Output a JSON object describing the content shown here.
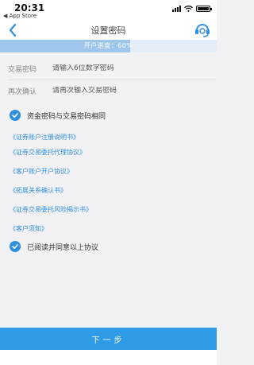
{
  "status_bar": {
    "time": "20:31",
    "back_app": "◀ App Store"
  },
  "nav": {
    "title": "设置密码",
    "back_icon": "chevron-left-icon",
    "service_icon": "customer-service-icon"
  },
  "progress": {
    "text": "开户进度：60%",
    "value": 0.6
  },
  "form": {
    "trade_password": {
      "label": "交易密码",
      "placeholder": "请输入6位数字密码"
    },
    "confirm_password": {
      "label": "再次确认",
      "placeholder": "请再次输入交易密码"
    }
  },
  "same_password_checkbox": {
    "label": "资金密码与交易密码相同",
    "checked": true
  },
  "agreements": [
    "《证券账户注册说明书》",
    "《证券交易委托代理协议》",
    "《客户账户开户协议》",
    "《拓展关系确认书》",
    "《证券交易委托风险揭示书》",
    "《客户须知》"
  ],
  "agree_checkbox": {
    "label": "已阅读并同意以上协议",
    "checked": true
  },
  "next_button": {
    "label": "下一步"
  },
  "colors": {
    "accent": "#2f8fe0",
    "button": "#2f9be6",
    "progress_fill": "#9fc7eb",
    "progress_track": "#e2edf7"
  }
}
